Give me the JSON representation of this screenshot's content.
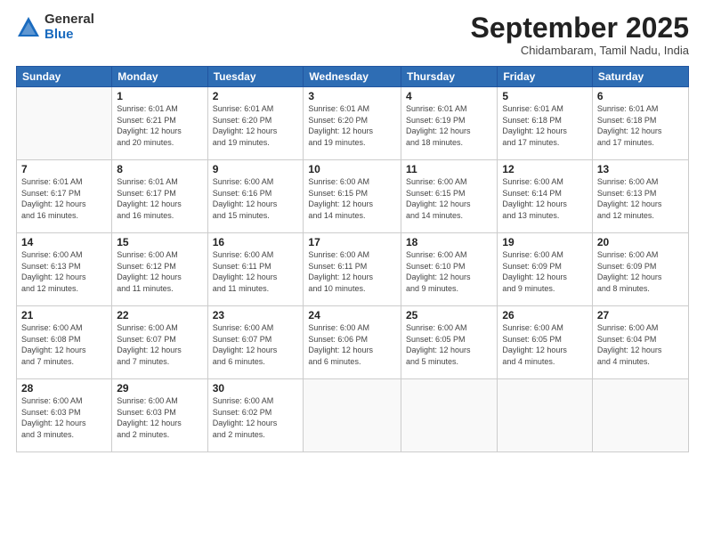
{
  "logo": {
    "general": "General",
    "blue": "Blue"
  },
  "title": "September 2025",
  "subtitle": "Chidambaram, Tamil Nadu, India",
  "headers": [
    "Sunday",
    "Monday",
    "Tuesday",
    "Wednesday",
    "Thursday",
    "Friday",
    "Saturday"
  ],
  "weeks": [
    [
      {
        "day": "",
        "info": ""
      },
      {
        "day": "1",
        "info": "Sunrise: 6:01 AM\nSunset: 6:21 PM\nDaylight: 12 hours\nand 20 minutes."
      },
      {
        "day": "2",
        "info": "Sunrise: 6:01 AM\nSunset: 6:20 PM\nDaylight: 12 hours\nand 19 minutes."
      },
      {
        "day": "3",
        "info": "Sunrise: 6:01 AM\nSunset: 6:20 PM\nDaylight: 12 hours\nand 19 minutes."
      },
      {
        "day": "4",
        "info": "Sunrise: 6:01 AM\nSunset: 6:19 PM\nDaylight: 12 hours\nand 18 minutes."
      },
      {
        "day": "5",
        "info": "Sunrise: 6:01 AM\nSunset: 6:18 PM\nDaylight: 12 hours\nand 17 minutes."
      },
      {
        "day": "6",
        "info": "Sunrise: 6:01 AM\nSunset: 6:18 PM\nDaylight: 12 hours\nand 17 minutes."
      }
    ],
    [
      {
        "day": "7",
        "info": "Sunrise: 6:01 AM\nSunset: 6:17 PM\nDaylight: 12 hours\nand 16 minutes."
      },
      {
        "day": "8",
        "info": "Sunrise: 6:01 AM\nSunset: 6:17 PM\nDaylight: 12 hours\nand 16 minutes."
      },
      {
        "day": "9",
        "info": "Sunrise: 6:00 AM\nSunset: 6:16 PM\nDaylight: 12 hours\nand 15 minutes."
      },
      {
        "day": "10",
        "info": "Sunrise: 6:00 AM\nSunset: 6:15 PM\nDaylight: 12 hours\nand 14 minutes."
      },
      {
        "day": "11",
        "info": "Sunrise: 6:00 AM\nSunset: 6:15 PM\nDaylight: 12 hours\nand 14 minutes."
      },
      {
        "day": "12",
        "info": "Sunrise: 6:00 AM\nSunset: 6:14 PM\nDaylight: 12 hours\nand 13 minutes."
      },
      {
        "day": "13",
        "info": "Sunrise: 6:00 AM\nSunset: 6:13 PM\nDaylight: 12 hours\nand 12 minutes."
      }
    ],
    [
      {
        "day": "14",
        "info": "Sunrise: 6:00 AM\nSunset: 6:13 PM\nDaylight: 12 hours\nand 12 minutes."
      },
      {
        "day": "15",
        "info": "Sunrise: 6:00 AM\nSunset: 6:12 PM\nDaylight: 12 hours\nand 11 minutes."
      },
      {
        "day": "16",
        "info": "Sunrise: 6:00 AM\nSunset: 6:11 PM\nDaylight: 12 hours\nand 11 minutes."
      },
      {
        "day": "17",
        "info": "Sunrise: 6:00 AM\nSunset: 6:11 PM\nDaylight: 12 hours\nand 10 minutes."
      },
      {
        "day": "18",
        "info": "Sunrise: 6:00 AM\nSunset: 6:10 PM\nDaylight: 12 hours\nand 9 minutes."
      },
      {
        "day": "19",
        "info": "Sunrise: 6:00 AM\nSunset: 6:09 PM\nDaylight: 12 hours\nand 9 minutes."
      },
      {
        "day": "20",
        "info": "Sunrise: 6:00 AM\nSunset: 6:09 PM\nDaylight: 12 hours\nand 8 minutes."
      }
    ],
    [
      {
        "day": "21",
        "info": "Sunrise: 6:00 AM\nSunset: 6:08 PM\nDaylight: 12 hours\nand 7 minutes."
      },
      {
        "day": "22",
        "info": "Sunrise: 6:00 AM\nSunset: 6:07 PM\nDaylight: 12 hours\nand 7 minutes."
      },
      {
        "day": "23",
        "info": "Sunrise: 6:00 AM\nSunset: 6:07 PM\nDaylight: 12 hours\nand 6 minutes."
      },
      {
        "day": "24",
        "info": "Sunrise: 6:00 AM\nSunset: 6:06 PM\nDaylight: 12 hours\nand 6 minutes."
      },
      {
        "day": "25",
        "info": "Sunrise: 6:00 AM\nSunset: 6:05 PM\nDaylight: 12 hours\nand 5 minutes."
      },
      {
        "day": "26",
        "info": "Sunrise: 6:00 AM\nSunset: 6:05 PM\nDaylight: 12 hours\nand 4 minutes."
      },
      {
        "day": "27",
        "info": "Sunrise: 6:00 AM\nSunset: 6:04 PM\nDaylight: 12 hours\nand 4 minutes."
      }
    ],
    [
      {
        "day": "28",
        "info": "Sunrise: 6:00 AM\nSunset: 6:03 PM\nDaylight: 12 hours\nand 3 minutes."
      },
      {
        "day": "29",
        "info": "Sunrise: 6:00 AM\nSunset: 6:03 PM\nDaylight: 12 hours\nand 2 minutes."
      },
      {
        "day": "30",
        "info": "Sunrise: 6:00 AM\nSunset: 6:02 PM\nDaylight: 12 hours\nand 2 minutes."
      },
      {
        "day": "",
        "info": ""
      },
      {
        "day": "",
        "info": ""
      },
      {
        "day": "",
        "info": ""
      },
      {
        "day": "",
        "info": ""
      }
    ]
  ]
}
